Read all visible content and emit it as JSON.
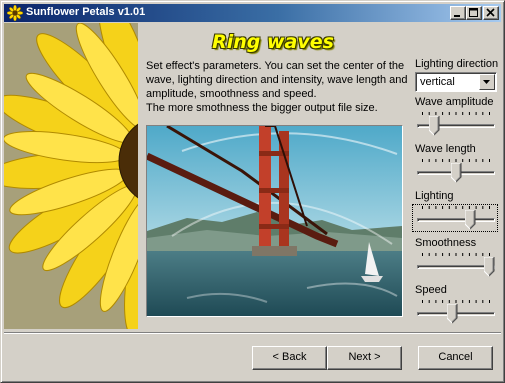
{
  "window": {
    "title": "Sunflower Petals v1.01"
  },
  "effect": {
    "title": "Ring waves",
    "description": [
      "Set effect's parameters. You can set the center of the",
      "wave, lighting direction and intensity, wave length and",
      "amplitude, smoothness and speed.",
      "The more smothness the bigger output file size."
    ]
  },
  "lighting_direction": {
    "label": "Lighting direction",
    "value": "vertical"
  },
  "sliders": {
    "wave_amplitude": {
      "label": "Wave amplitude",
      "position_fraction": 0.18
    },
    "wave_length": {
      "label": "Wave length",
      "position_fraction": 0.5
    },
    "lighting": {
      "label": "Lighting",
      "position_fraction": 0.72
    },
    "smoothness": {
      "label": "Smoothness",
      "position_fraction": 1.0
    },
    "speed": {
      "label": "Speed",
      "position_fraction": 0.45
    }
  },
  "buttons": {
    "back": "< Back",
    "next": "Next >",
    "cancel": "Cancel"
  },
  "icons": {
    "app": "sunflower-icon",
    "minimize": "minimize-icon",
    "maximize": "maximize-icon",
    "close": "close-icon",
    "dropdown": "chevron-down-icon"
  },
  "colors": {
    "titlebar_start": "#0a246a",
    "titlebar_end": "#a6caf0",
    "effect_title": "#ffff00",
    "side_panel": "#a7a07a"
  }
}
